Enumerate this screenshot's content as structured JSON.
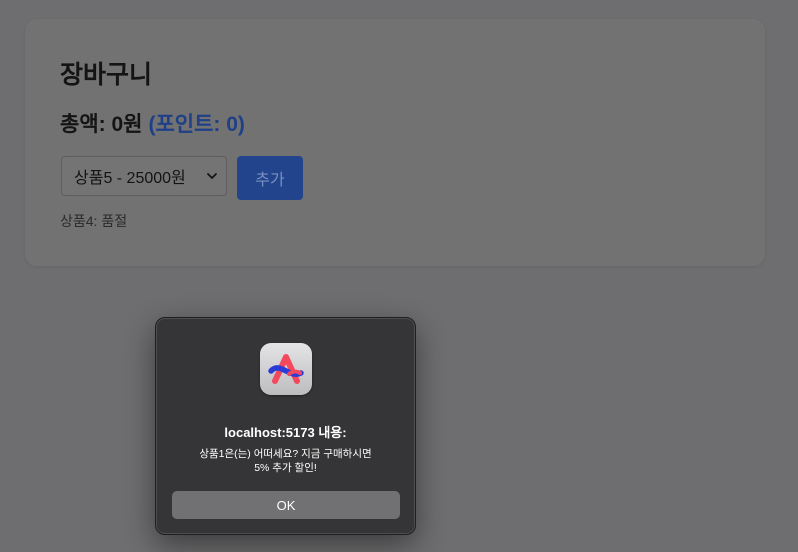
{
  "cart": {
    "title": "장바구니",
    "total_label": "총액: 0원",
    "points_label": "(포인트: 0)",
    "product_select": {
      "selected": "상품5 - 25000원"
    },
    "add_button_label": "추가",
    "stock_status": "상품4: 품절"
  },
  "alert_dialog": {
    "app_icon": "arc-browser-icon",
    "title": "localhost:5173 내용:",
    "message_line1": "상품1은(는) 어떠세요? 지금 구매하시면",
    "message_line2": "5% 추가 할인!",
    "ok_label": "OK"
  },
  "colors": {
    "overlay_background": "#6e6e70",
    "card_background": "#727273",
    "points_accent": "#1f3f86",
    "add_button": "#21448c",
    "dialog_background": "#353537",
    "dialog_button": "#717173"
  }
}
